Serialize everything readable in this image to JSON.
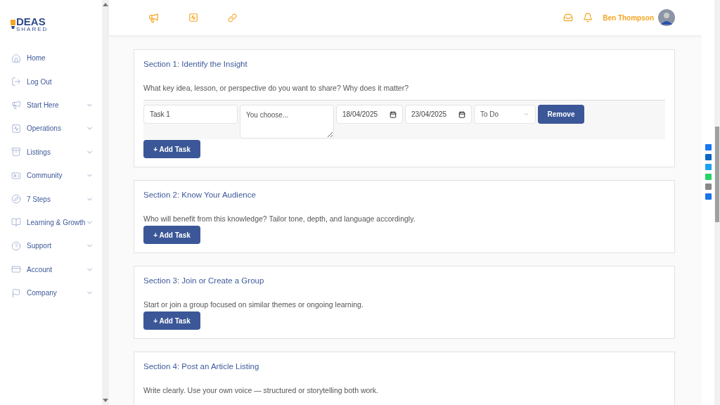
{
  "logo": {
    "word": "DEAS",
    "tagline": "SHARED"
  },
  "sidebar": {
    "items": [
      {
        "label": "Home",
        "expandable": false
      },
      {
        "label": "Log Out",
        "expandable": false
      },
      {
        "label": "Start Here",
        "expandable": true
      },
      {
        "label": "Operations",
        "expandable": true
      },
      {
        "label": "Listings",
        "expandable": true
      },
      {
        "label": "Community",
        "expandable": true
      },
      {
        "label": "7 Steps",
        "expandable": true
      },
      {
        "label": "Learning & Growth",
        "expandable": true
      },
      {
        "label": "Support",
        "expandable": true
      },
      {
        "label": "Account",
        "expandable": true
      },
      {
        "label": "Company",
        "expandable": true
      }
    ]
  },
  "header": {
    "user": {
      "name": "Ben Thompson"
    }
  },
  "sections": [
    {
      "title": "Section 1: Identify the Insight",
      "description": "What key idea, lesson, or perspective do you want to share? Why does it matter?",
      "tasks": [
        {
          "name": "Task 1",
          "notes_placeholder": "You choose...",
          "start": "18/04/2025",
          "end": "23/04/2025",
          "status": "To Do",
          "remove": "Remove"
        }
      ],
      "add_button": "+ Add Task"
    },
    {
      "title": "Section 2: Know Your Audience",
      "description": "Who will benefit from this knowledge? Tailor tone, depth, and language accordingly.",
      "add_button": "+ Add Task"
    },
    {
      "title": "Section 3: Join or Create a Group",
      "description": "Start or join a group focused on similar themes or ongoing learning.",
      "add_button": "+ Add Task"
    },
    {
      "title": "Section 4: Post an Article Listing",
      "description": "Write clearly. Use your own voice — structured or storytelling both work."
    }
  ]
}
